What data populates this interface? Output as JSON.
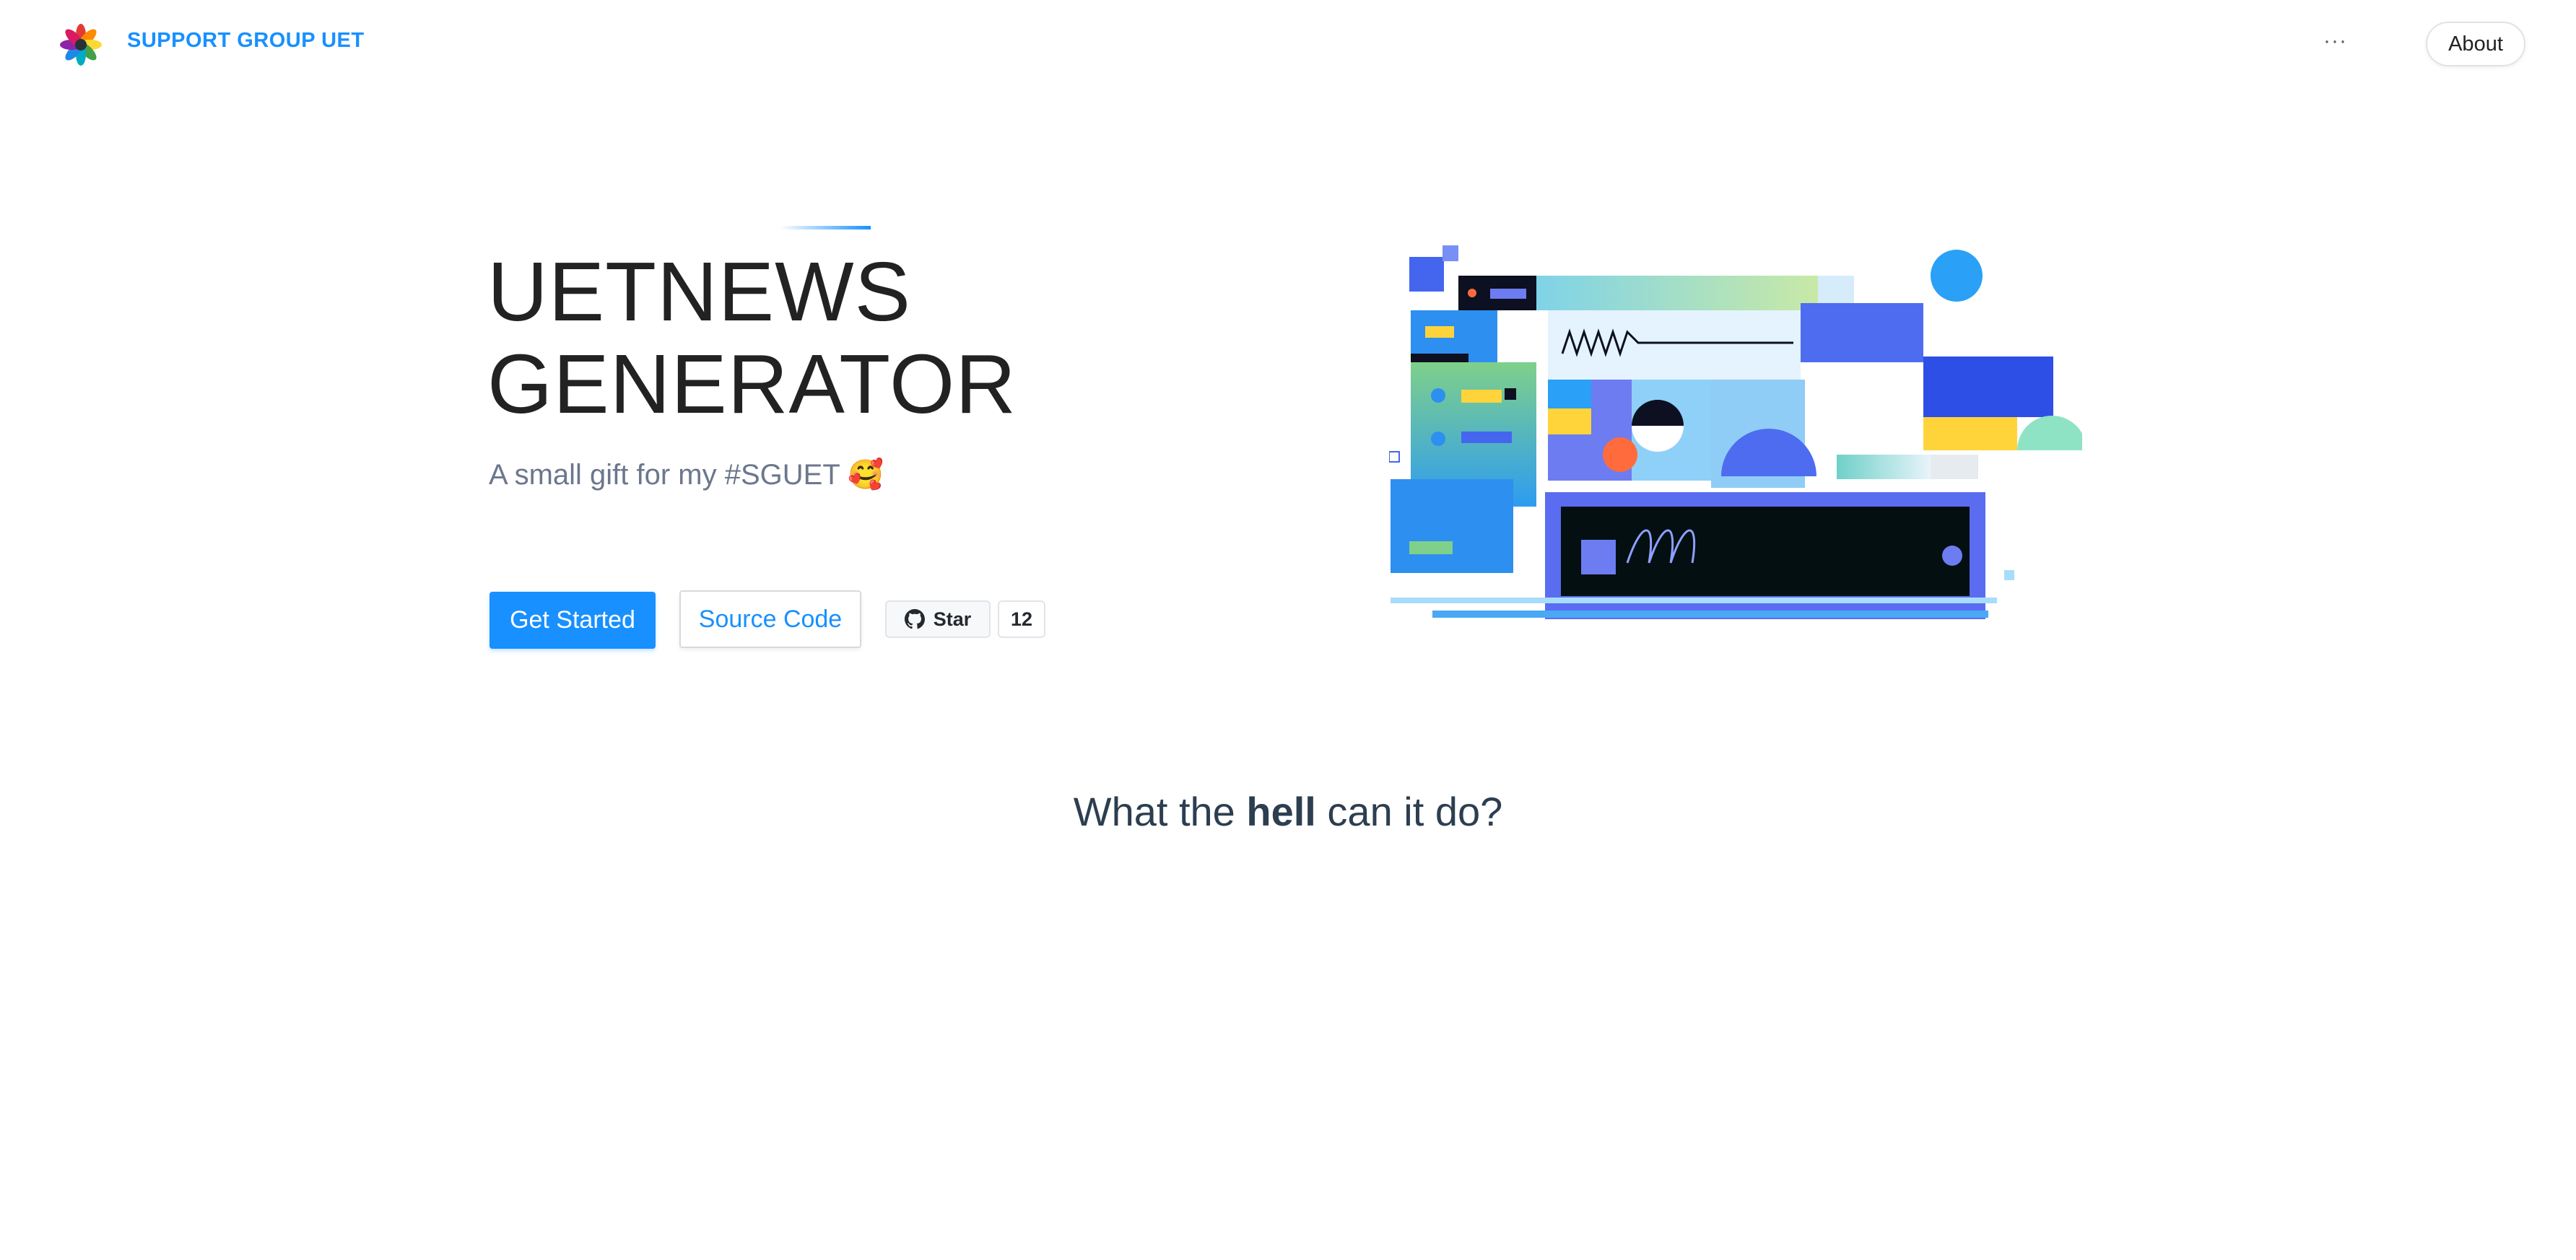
{
  "header": {
    "brand": "SUPPORT GROUP UET",
    "more_label": "···",
    "about_label": "About"
  },
  "hero": {
    "title_line1": "UETNEWS",
    "title_line2": "GENERATOR",
    "subtitle": "A small gift for my #SGUET 🥰",
    "primary_button": "Get Started",
    "secondary_button": "Source Code",
    "github_star_label": "Star",
    "github_star_count": "12"
  },
  "section": {
    "heading_before": "What the",
    "heading_bold": "hell",
    "heading_after": "can it do?"
  },
  "icons": {
    "logo": "flower-logo-icon",
    "github": "github-icon",
    "more": "ellipsis-icon"
  },
  "colors": {
    "accent": "#1890ff",
    "title": "#222222",
    "subtitle": "#6b778c"
  }
}
